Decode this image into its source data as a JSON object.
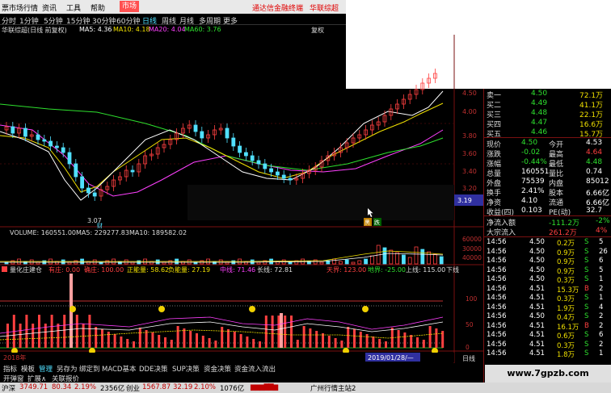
{
  "menu": {
    "items": [
      "票市场行情",
      "资讯",
      "工具",
      "帮助",
      "市场"
    ],
    "promo": "通达信金融终端",
    "stock_name": "华联综超"
  },
  "periods": [
    "分时",
    "1分钟",
    "5分钟",
    "15分钟",
    "30分钟",
    "60分钟",
    "日线",
    "周线",
    "月线",
    "多周期",
    "更多"
  ],
  "chart_title": {
    "name": "华联综超(日线 前复权)",
    "ma5": "MA5: 4.36",
    "ma10": "MA10: 4.18",
    "ma20": "MA20: 4.04",
    "ma60": "MA60: 3.76",
    "right": "复权"
  },
  "price_axis": [
    "4.50",
    "4.00",
    "3.80",
    "3.60",
    "3.40",
    "3.20",
    "3.19"
  ],
  "low_label": "3.07",
  "volume": {
    "title": "VOLUME: 160551.00",
    "ma5": "MA5: 229277.83",
    "ma10": "MA10: 189582.02",
    "axis": [
      "60000",
      "30000",
      "40000"
    ]
  },
  "indicator": {
    "title": "量化庄建仓",
    "a": "有庄: 0.00",
    "b": "确庄: 100.00",
    "c": "正能量: 58.62",
    "d": "负能量: 27.19",
    "e": "中线: 71.46",
    "f": "长线: 72.81",
    "g": "天界: 123.00",
    "h": "地界: -25.00",
    "i": "上线: 115.00",
    "j": "下线",
    "axis": [
      "100",
      "50",
      "0"
    ]
  },
  "markers": {
    "m1": "财",
    "m2": "黑",
    "m3": "跌"
  },
  "date_bar": {
    "d1": "2018年",
    "d2": "2019/01/28/—",
    "right": "日线"
  },
  "bottom_tabs": [
    "指标",
    "模板",
    "管理",
    "另存为",
    "绑定到",
    "MACD基本",
    "DDE决策",
    "SUP决策",
    "资金决策",
    "资金流入流出"
  ],
  "tabs2": [
    "开弹窗",
    "扩展∧",
    "关联报价"
  ],
  "quote": {
    "asks": [
      [
        "卖一",
        "4.50",
        "72.1万"
      ],
      [
        "买二",
        "4.49",
        "41.1万"
      ],
      [
        "买三",
        "4.48",
        "22.1万"
      ],
      [
        "买四",
        "4.47",
        "16.6万"
      ],
      [
        "买五",
        "4.46",
        "15.7万"
      ]
    ],
    "stats": [
      [
        "现价",
        "4.50",
        "今开",
        "4.53"
      ],
      [
        "涨跌",
        "-0.02",
        "最高",
        "4.64"
      ],
      [
        "涨幅",
        "-0.44%",
        "最低",
        "4.48"
      ],
      [
        "总量",
        "160551",
        "量比",
        "0.74"
      ],
      [
        "外盘",
        "75539",
        "内盘",
        "85012"
      ],
      [
        "换手",
        "2.41%",
        "股本",
        "6.66亿"
      ],
      [
        "净资",
        "4.10",
        "流通",
        "6.66亿"
      ],
      [
        "收益(四)",
        "0.103",
        "PE(动)",
        "32.7"
      ]
    ],
    "flow": [
      [
        "净流入额",
        "-111.2万",
        "-2%"
      ],
      [
        "大宗流入",
        "261.2万",
        "4%"
      ]
    ],
    "ticks": [
      [
        "14:56",
        "4.50",
        "0.2万",
        "S"
      ],
      [
        "14:56",
        "4.50",
        "0.9万",
        "S"
      ],
      [
        "14:56",
        "4.50",
        "0.9万",
        "S"
      ],
      [
        "14:56",
        "4.50",
        "0.9万",
        "S"
      ],
      [
        "14:56",
        "4.50",
        "0.3万",
        "S"
      ],
      [
        "14:56",
        "4.51",
        "15.3万",
        "B"
      ],
      [
        "14:56",
        "4.51",
        "0.3万",
        "S"
      ],
      [
        "14:56",
        "4.51",
        "1.9万",
        "S"
      ],
      [
        "14:56",
        "4.50",
        "0.4万",
        "S"
      ],
      [
        "14:56",
        "4.51",
        "16.1万",
        "B"
      ],
      [
        "14:56",
        "4.51",
        "0.6万",
        "S"
      ],
      [
        "14:56",
        "4.51",
        "0.3万",
        "S"
      ],
      [
        "14:56",
        "4.51",
        "1.8万",
        "S"
      ]
    ],
    "tick_counts": [
      "5",
      "26",
      "6",
      "5",
      "1",
      "2",
      "1",
      "4",
      "2",
      "2",
      "6",
      "2",
      "1"
    ]
  },
  "statusbar": {
    "sh_label": "沪深",
    "sh": "3749.71",
    "sh_chg": "80.34",
    "sh_pct": "2.19%",
    "sh_amt": "2356亿",
    "cy_label": "创业",
    "cy": "1567.87",
    "cy_chg": "32.19",
    "cy_pct": "2.10%",
    "cy_amt": "1076亿",
    "server": "广州行情主站2"
  },
  "watermark": "www.7gpzb.com",
  "colors": {
    "up": "#ff4040",
    "down": "#2ee02e",
    "ma5": "#ffffff",
    "ma10": "#f0e000",
    "ma20": "#ff40ff",
    "ma60": "#2ee02e"
  }
}
